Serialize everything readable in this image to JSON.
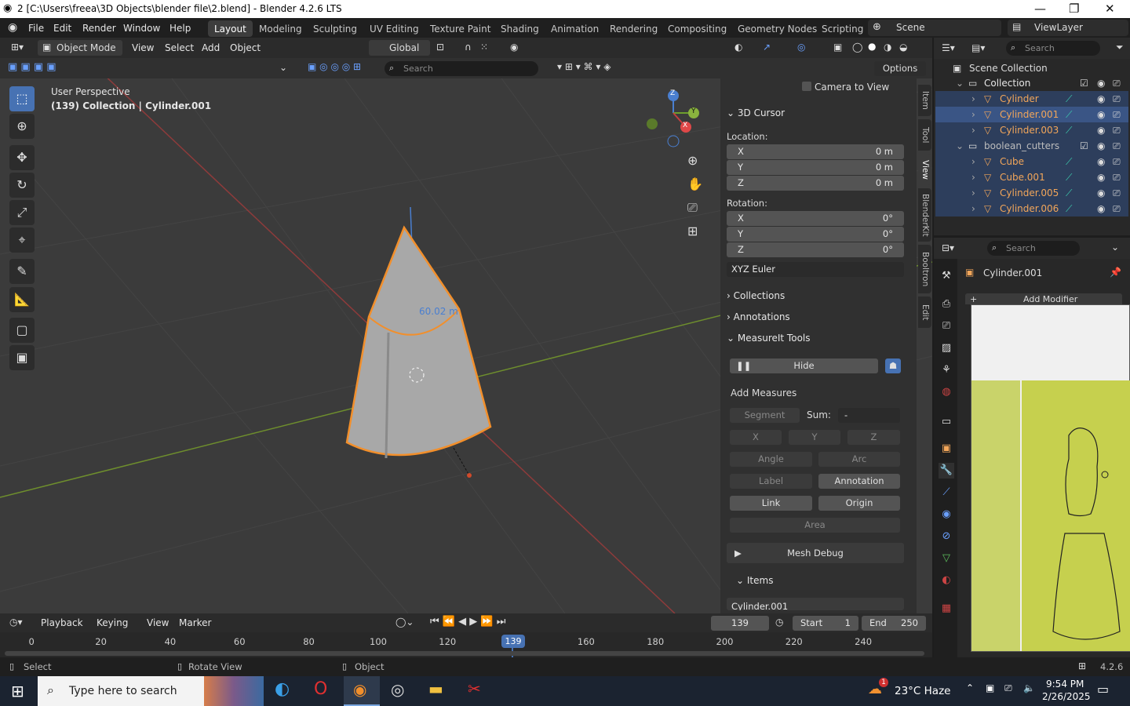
{
  "window": {
    "title": "2 [C:\\Users\\freea\\3D Objects\\blender file\\2.blend] - Blender 4.2.6 LTS"
  },
  "menu": [
    "File",
    "Edit",
    "Render",
    "Window",
    "Help"
  ],
  "workspaces": [
    "Layout",
    "Modeling",
    "Sculpting",
    "UV Editing",
    "Texture Paint",
    "Shading",
    "Animation",
    "Rendering",
    "Compositing",
    "Geometry Nodes",
    "Scripting"
  ],
  "scene": "Scene",
  "view_layer": "ViewLayer",
  "vp_header": {
    "mode": "Object Mode",
    "menus": [
      "View",
      "Select",
      "Add",
      "Object"
    ],
    "orientation": "Global",
    "search_placeholder": "Search",
    "options": "Options"
  },
  "overlay": {
    "line1": "User Perspective",
    "line2": "(139) Collection | Cylinder.001",
    "measure": "60.02 m"
  },
  "gizmo": {
    "x": "X",
    "y": "Y",
    "z": "Z"
  },
  "npanel": {
    "camera_to_view": "Camera to View",
    "cursor_title": "3D Cursor",
    "location_label": "Location:",
    "location": [
      {
        "axis": "X",
        "value": "0 m"
      },
      {
        "axis": "Y",
        "value": "0 m"
      },
      {
        "axis": "Z",
        "value": "0 m"
      }
    ],
    "rotation_label": "Rotation:",
    "rotation": [
      {
        "axis": "X",
        "value": "0°"
      },
      {
        "axis": "Y",
        "value": "0°"
      },
      {
        "axis": "Z",
        "value": "0°"
      }
    ],
    "euler": "XYZ Euler",
    "collections": "Collections",
    "annotations": "Annotations",
    "measureit": "MeasureIt Tools",
    "hide": "Hide",
    "add_measures": "Add Measures",
    "segment": "Segment",
    "sum": "Sum:",
    "sum_val": "-",
    "x": "X",
    "y": "Y",
    "z": "Z",
    "angle": "Angle",
    "arc": "Arc",
    "label": "Label",
    "annotation": "Annotation",
    "link": "Link",
    "origin": "Origin",
    "area": "Area",
    "mesh_debug": "Mesh Debug",
    "items": "Items",
    "item0": "Cylinder.001"
  },
  "vtabs": [
    "Item",
    "Tool",
    "View",
    "BlenderKit",
    "Booltron",
    "Edit"
  ],
  "outliner": {
    "search": "Search",
    "root": "Scene Collection",
    "rows": [
      {
        "name": "Collection",
        "depth": 0,
        "color": "#e6e6e6"
      },
      {
        "name": "Cylinder",
        "depth": 1,
        "color": "#f2a65a"
      },
      {
        "name": "Cylinder.001",
        "depth": 1,
        "color": "#f2a65a"
      },
      {
        "name": "Cylinder.003",
        "depth": 1,
        "color": "#f2a65a"
      },
      {
        "name": "boolean_cutters",
        "depth": 0,
        "color": "#bdbdbd"
      },
      {
        "name": "Cube",
        "depth": 1,
        "color": "#f2a65a"
      },
      {
        "name": "Cube.001",
        "depth": 1,
        "color": "#f2a65a"
      },
      {
        "name": "Cylinder.005",
        "depth": 1,
        "color": "#f2a65a"
      },
      {
        "name": "Cylinder.006",
        "depth": 1,
        "color": "#f2a65a"
      }
    ]
  },
  "properties": {
    "search": "Search",
    "object": "Cylinder.001",
    "add_modifier": "Add Modifier"
  },
  "timeline": {
    "menus": [
      "Playback",
      "Keying",
      "View",
      "Marker"
    ],
    "frame": "139",
    "start_label": "Start",
    "start": "1",
    "end_label": "End",
    "end": "250",
    "ticks": [
      "0",
      "20",
      "40",
      "60",
      "80",
      "100",
      "120",
      "140",
      "160",
      "180",
      "200",
      "220",
      "240"
    ],
    "current": "139"
  },
  "status": {
    "select": "Select",
    "rotate": "Rotate View",
    "object": "Object",
    "version": "4.2.6"
  },
  "taskbar": {
    "search": "Type here to search",
    "weather": "23°C  Haze",
    "time": "9:54 PM",
    "date": "2/26/2025",
    "badge": "1"
  },
  "colors": {
    "accent": "#4772b3",
    "selected": "#f28f2b"
  }
}
